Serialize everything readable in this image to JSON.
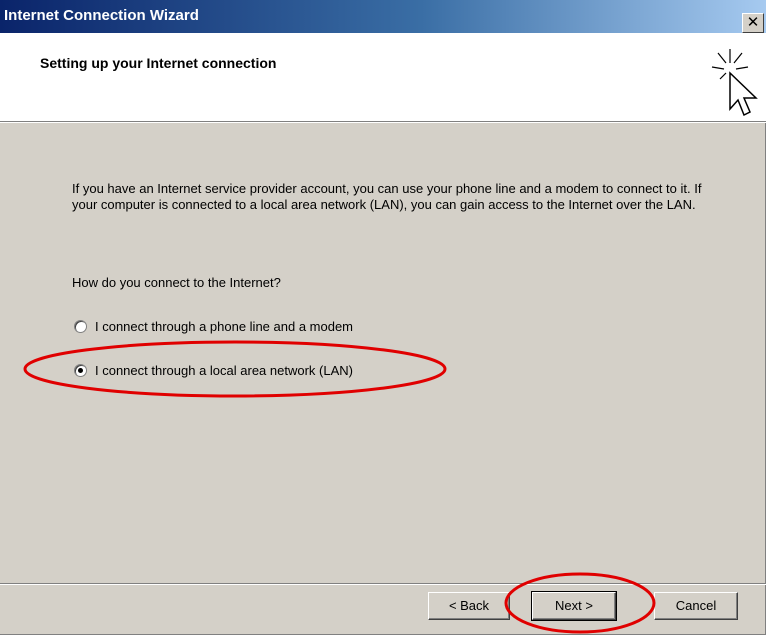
{
  "window": {
    "title": "Internet Connection Wizard",
    "close_glyph": "✕"
  },
  "header": {
    "title": "Setting up your Internet connection",
    "icon": "wizard-cursor-icon"
  },
  "body": {
    "description": "If you have an Internet service provider account, you can use your phone line and a modem to connect to it. If your computer is connected to a local area network (LAN), you can gain access to the Internet over the LAN.",
    "question": "How do you connect to the Internet?",
    "options": [
      {
        "label": "I connect through a phone line and a modem",
        "selected": false
      },
      {
        "label": "I connect through a local area network (LAN)",
        "selected": true
      }
    ]
  },
  "buttons": {
    "back": "< Back",
    "next": "Next >",
    "cancel": "Cancel"
  },
  "annotations": {
    "highlight_color": "#e00000"
  }
}
